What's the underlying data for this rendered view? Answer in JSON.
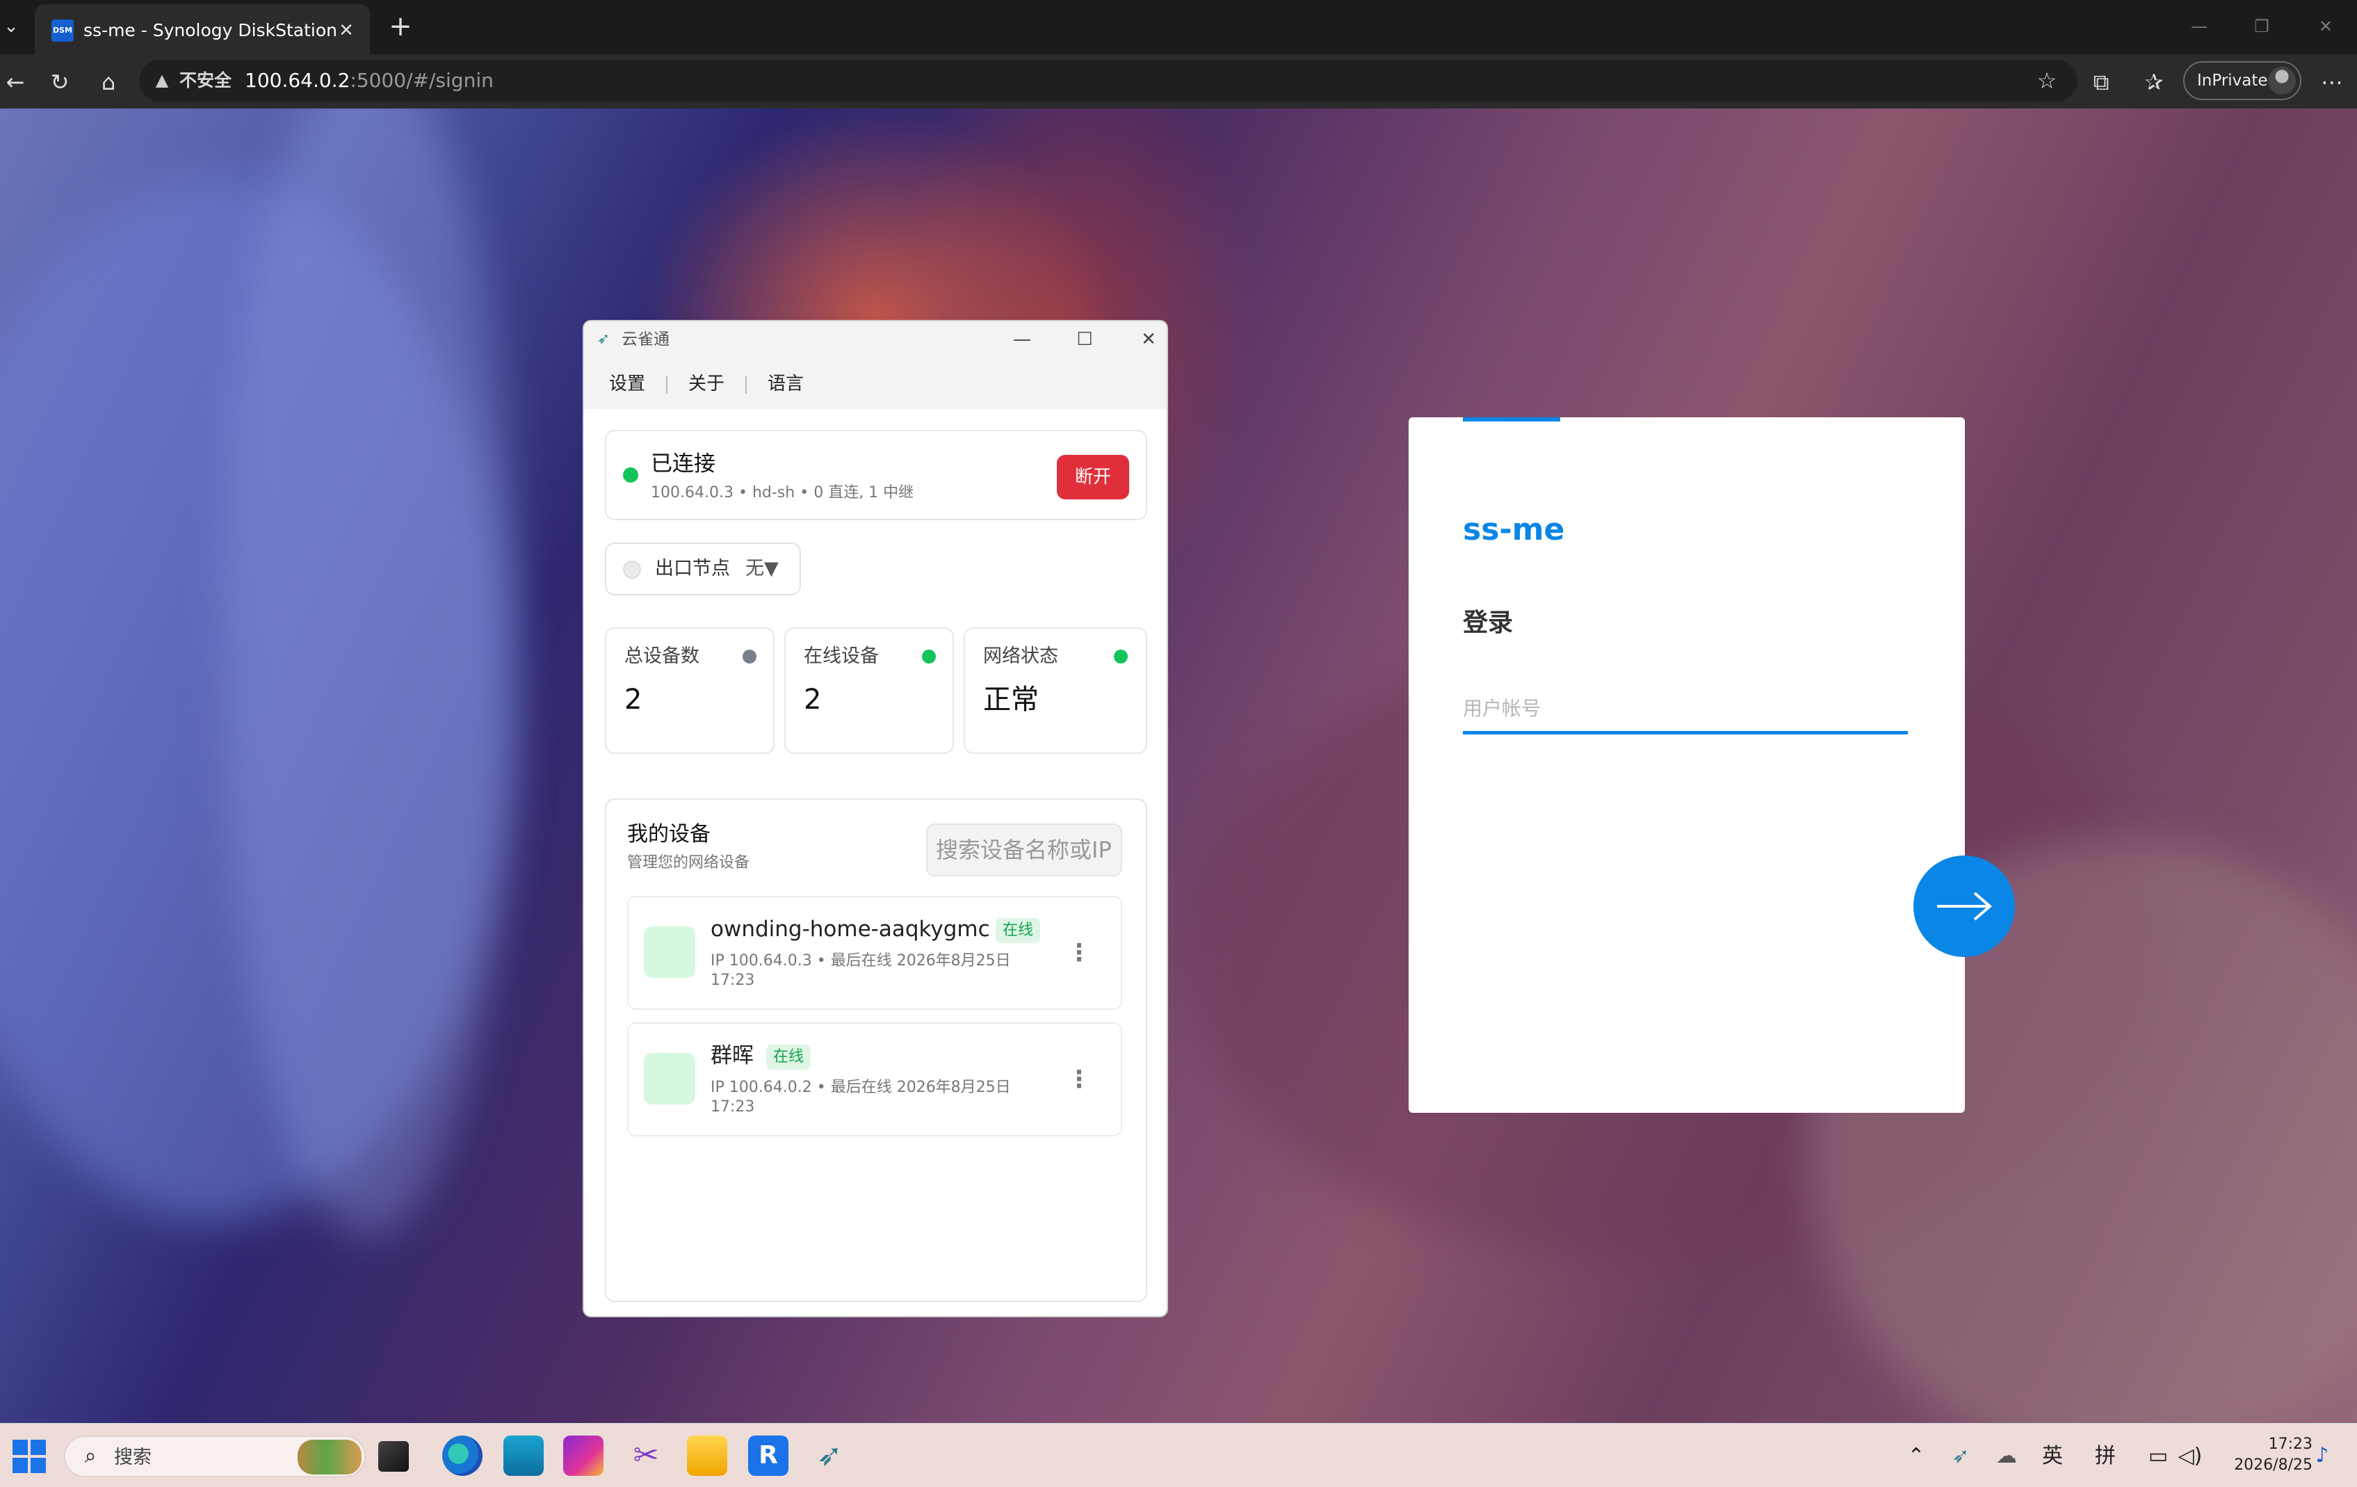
{
  "browser": {
    "tab_title": "ss-me - Synology DiskStation",
    "favicon_text": "DSM",
    "security_label": "不安全",
    "url_host": "100.64.0.2",
    "url_rest": ":5000/#/signin",
    "inprivate_label": "InPrivate"
  },
  "app": {
    "window_title": "云雀通",
    "menu": [
      "设置",
      "关于",
      "语言"
    ],
    "connection": {
      "status": "已连接",
      "ip": "100.64.0.3",
      "node": "hd-sh",
      "links": "0 直连, 1 中继",
      "disconnect_label": "断开",
      "status_color": "#16c35a"
    },
    "exit_node": {
      "label": "出口节点",
      "value": "无▼"
    },
    "stats": [
      {
        "title": "总设备数",
        "value": "2",
        "dot_color": "#7a7f8c"
      },
      {
        "title": "在线设备",
        "value": "2",
        "dot_color": "#16c35a"
      },
      {
        "title": "网络状态",
        "value": "正常",
        "dot_color": "#16c35a"
      }
    ],
    "devices": {
      "title": "我的设备",
      "subtitle": "管理您的网络设备",
      "search_placeholder": "搜索设备名称或IP",
      "items": [
        {
          "name": "ownding-home-aaqkygmc",
          "badge": "在线",
          "ip": "IP 100.64.0.3",
          "last_seen": "最后在线 2026年8月25日",
          "time": "17:23"
        },
        {
          "name": "群晖",
          "badge": "在线",
          "ip": "IP 100.64.0.2",
          "last_seen": "最后在线 2026年8月25日",
          "time": "17:23"
        }
      ]
    }
  },
  "dsm_login": {
    "hostname": "ss-me",
    "title": "登录",
    "username_placeholder": "用户帐号",
    "accent_color": "#0a86e6"
  },
  "taskbar": {
    "search_label": "搜索",
    "ime_lang": "英",
    "ime_mode": "拼",
    "time": "17:23",
    "date": "2026/8/25"
  }
}
